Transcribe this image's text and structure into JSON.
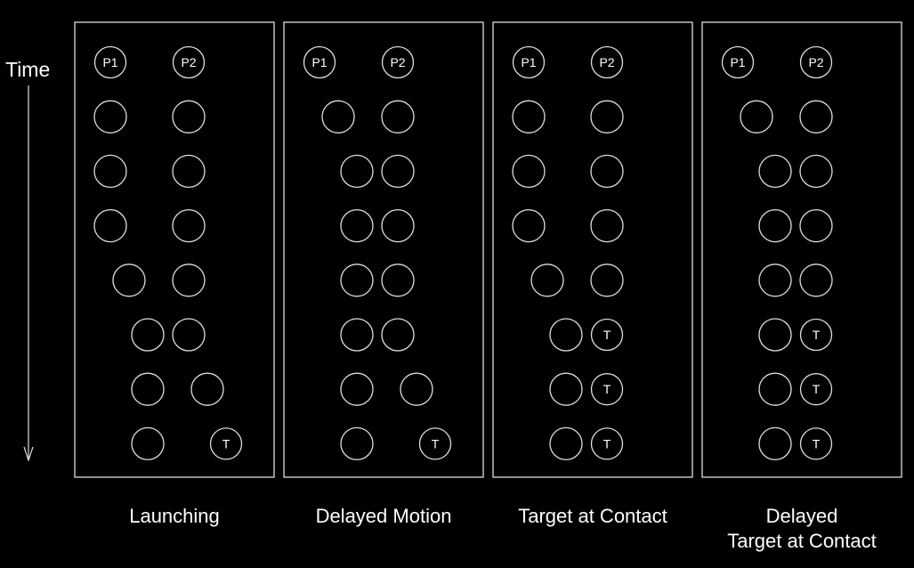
{
  "axis": {
    "time_label": "Time"
  },
  "tokens": {
    "p1": "P1",
    "p2": "P2",
    "target": "T"
  },
  "colors": {
    "background": "#000000",
    "stroke": "#dddddd",
    "text": "#ffffff"
  },
  "panels": [
    {
      "caption_lines": [
        "Launching"
      ],
      "labels_row": [
        "P1",
        "P2"
      ],
      "frames": [
        {
          "p1": 0,
          "p2": 0,
          "p2_is_target": false
        },
        {
          "p1": 0,
          "p2": 0,
          "p2_is_target": false
        },
        {
          "p1": 0,
          "p2": 0,
          "p2_is_target": false
        },
        {
          "p1": 1,
          "p2": 0,
          "p2_is_target": false
        },
        {
          "p1": 2,
          "p2": 0,
          "p2_is_target": false
        },
        {
          "p1": 2,
          "p2": 1,
          "p2_is_target": false
        },
        {
          "p1": 2,
          "p2": 2,
          "p2_is_target": true
        }
      ]
    },
    {
      "caption_lines": [
        "Delayed Motion"
      ],
      "labels_row": [
        "P1",
        "P2"
      ],
      "frames": [
        {
          "p1": 1,
          "p2": 0,
          "p2_is_target": false
        },
        {
          "p1": 2,
          "p2": 0,
          "p2_is_target": false
        },
        {
          "p1": 2,
          "p2": 0,
          "p2_is_target": false
        },
        {
          "p1": 2,
          "p2": 0,
          "p2_is_target": false
        },
        {
          "p1": 2,
          "p2": 0,
          "p2_is_target": false
        },
        {
          "p1": 2,
          "p2": 1,
          "p2_is_target": false
        },
        {
          "p1": 2,
          "p2": 2,
          "p2_is_target": true
        }
      ]
    },
    {
      "caption_lines": [
        "Target at Contact"
      ],
      "labels_row": [
        "P1",
        "P2"
      ],
      "frames": [
        {
          "p1": 0,
          "p2": 0,
          "p2_is_target": false
        },
        {
          "p1": 0,
          "p2": 0,
          "p2_is_target": false
        },
        {
          "p1": 0,
          "p2": 0,
          "p2_is_target": false
        },
        {
          "p1": 1,
          "p2": 0,
          "p2_is_target": false
        },
        {
          "p1": 2,
          "p2": 0,
          "p2_is_target": true
        },
        {
          "p1": 2,
          "p2": 0,
          "p2_is_target": true
        },
        {
          "p1": 2,
          "p2": 0,
          "p2_is_target": true
        }
      ]
    },
    {
      "caption_lines": [
        "Delayed",
        "Target at Contact"
      ],
      "labels_row": [
        "P1",
        "P2"
      ],
      "frames": [
        {
          "p1": 1,
          "p2": 0,
          "p2_is_target": false
        },
        {
          "p1": 2,
          "p2": 0,
          "p2_is_target": false
        },
        {
          "p1": 2,
          "p2": 0,
          "p2_is_target": false
        },
        {
          "p1": 2,
          "p2": 0,
          "p2_is_target": false
        },
        {
          "p1": 2,
          "p2": 0,
          "p2_is_target": true
        },
        {
          "p1": 2,
          "p2": 0,
          "p2_is_target": true
        },
        {
          "p1": 2,
          "p2": 0,
          "p2_is_target": true
        }
      ]
    }
  ]
}
